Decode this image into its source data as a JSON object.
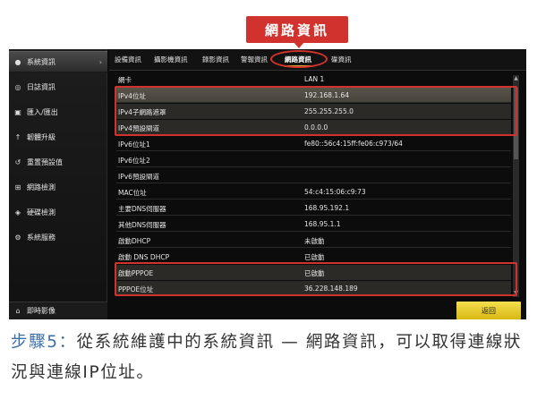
{
  "callout": {
    "label": "網路資訊"
  },
  "sidebar": {
    "items": [
      {
        "label": "系統資訊",
        "icon": "info-icon"
      },
      {
        "label": "日誌資訊",
        "icon": "log-icon"
      },
      {
        "label": "匯入/匯出",
        "icon": "import-icon"
      },
      {
        "label": "韌體升級",
        "icon": "upgrade-icon"
      },
      {
        "label": "重置預設值",
        "icon": "reset-icon"
      },
      {
        "label": "網路檢測",
        "icon": "network-icon"
      },
      {
        "label": "硬碟檢測",
        "icon": "disk-icon"
      },
      {
        "label": "系統服務",
        "icon": "service-icon"
      }
    ],
    "bottom": {
      "label": "即時影像"
    }
  },
  "tabs": [
    {
      "label": "設備資訊"
    },
    {
      "label": "攝影機資訊"
    },
    {
      "label": "錄影資訊"
    },
    {
      "label": "警報資訊"
    },
    {
      "label": "網路資訊",
      "active": true
    },
    {
      "label": "碟資訊"
    }
  ],
  "table": {
    "rows": [
      {
        "key": "網卡",
        "value": "LAN 1"
      },
      {
        "key": "IPv4位址",
        "value": "192.168.1.64"
      },
      {
        "key": "IPv4子網路遮罩",
        "value": "255.255.255.0"
      },
      {
        "key": "IPv4預設閘道",
        "value": "0.0.0.0"
      },
      {
        "key": "IPv6位址1",
        "value": "fe80::56c4:15ff:fe06:c973/64"
      },
      {
        "key": "IPv6位址2",
        "value": ""
      },
      {
        "key": "IPv6預設閘道",
        "value": ""
      },
      {
        "key": "MAC位址",
        "value": "54:c4:15:06:c9:73"
      },
      {
        "key": "主要DNS伺服器",
        "value": "168.95.192.1"
      },
      {
        "key": "其他DNS伺服器",
        "value": "168.95.1.1"
      },
      {
        "key": "啟動DHCP",
        "value": "未啟動"
      },
      {
        "key": "啟動 DNS DHCP",
        "value": "已啟動"
      },
      {
        "key": "啟動PPPOE",
        "value": "已啟動"
      },
      {
        "key": "PPPOE位址",
        "value": "36.228.148.189"
      }
    ]
  },
  "buttons": {
    "back": "返回"
  },
  "caption": {
    "step": "步驟5：",
    "text": "從系統維護中的系統資訊 — 網路資訊，可以取得連線狀況與連線IP位址。"
  },
  "colors": {
    "highlight": "#d2322d",
    "accent_button": "#e6c82c",
    "caption_step": "#3c6ea8"
  }
}
